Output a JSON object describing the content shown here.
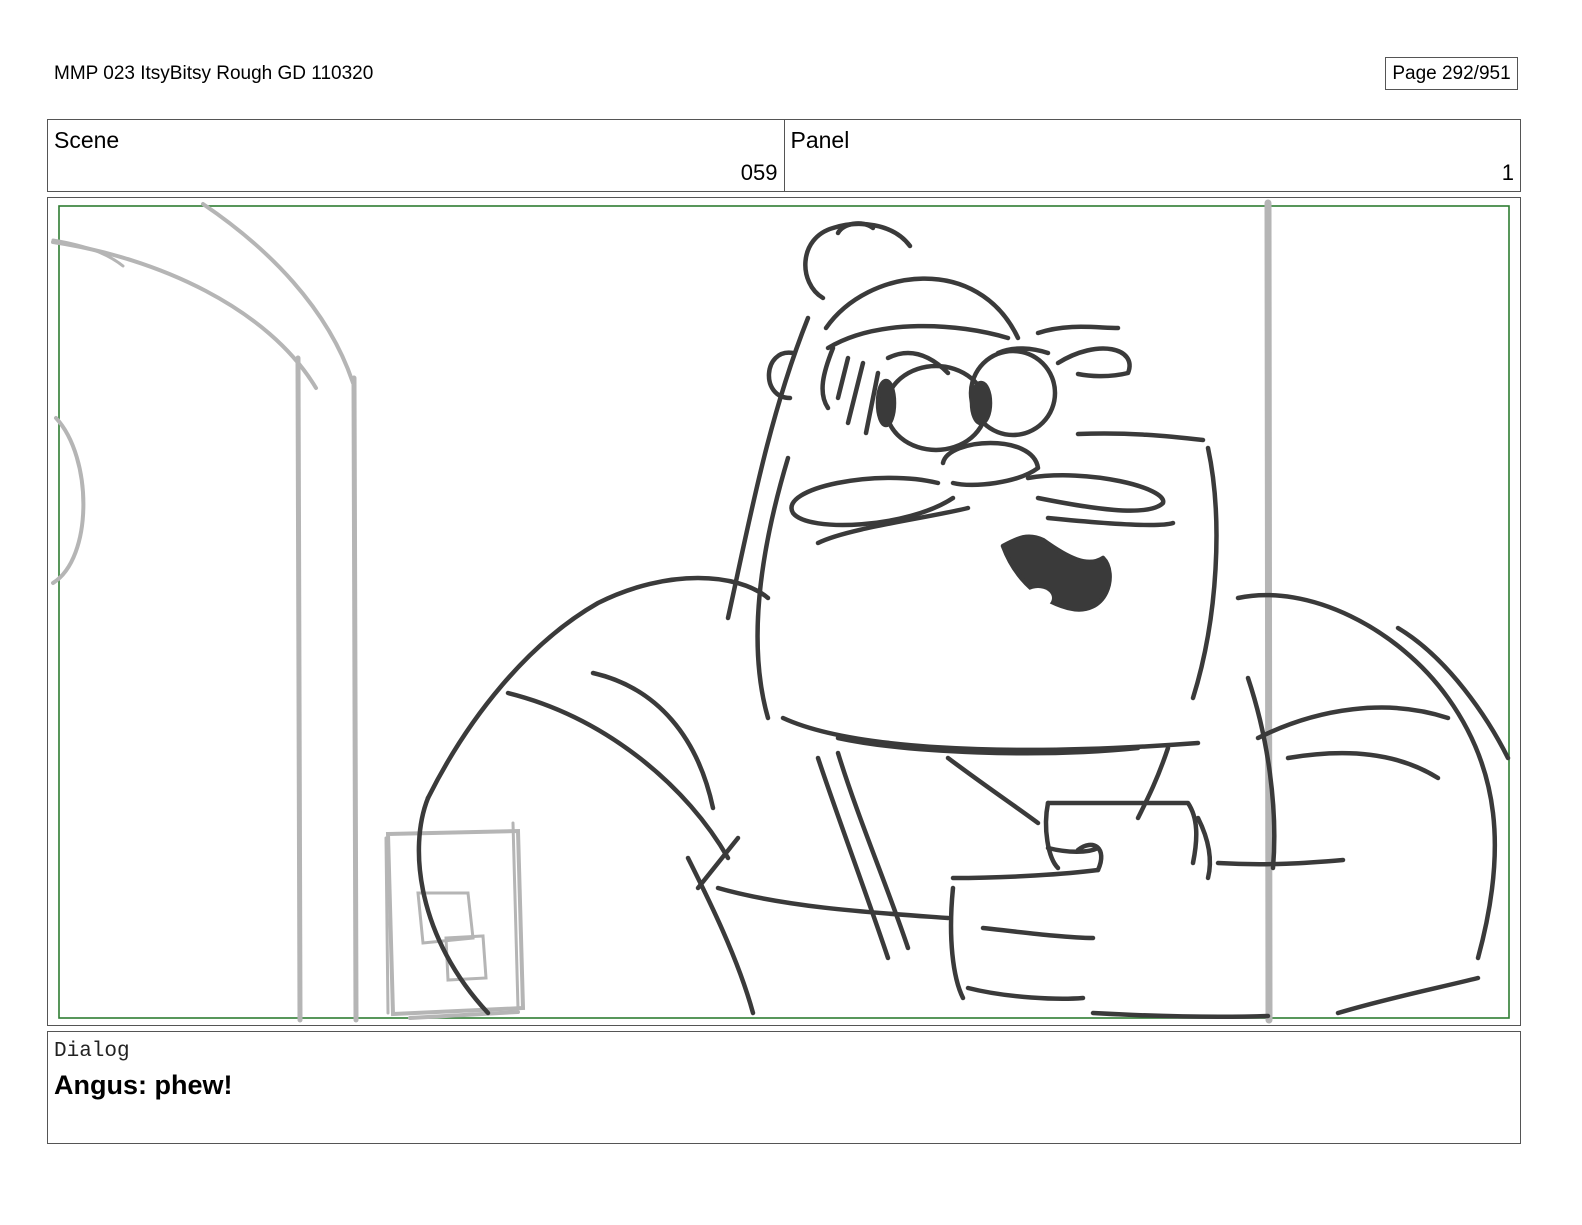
{
  "header": {
    "document_title": "MMP 023 ItsyBitsy Rough GD 110320",
    "page_label": "Page 292/951"
  },
  "info": {
    "scene_label": "Scene",
    "scene_value": "059",
    "panel_label": "Panel",
    "panel_value": "1"
  },
  "dialog": {
    "label": "Dialog",
    "text": "Angus: phew!"
  },
  "colors": {
    "safe_frame": "#2e7d32",
    "sketch_line": "#3a3a3a",
    "background_sketch": "#b5b5b5"
  }
}
